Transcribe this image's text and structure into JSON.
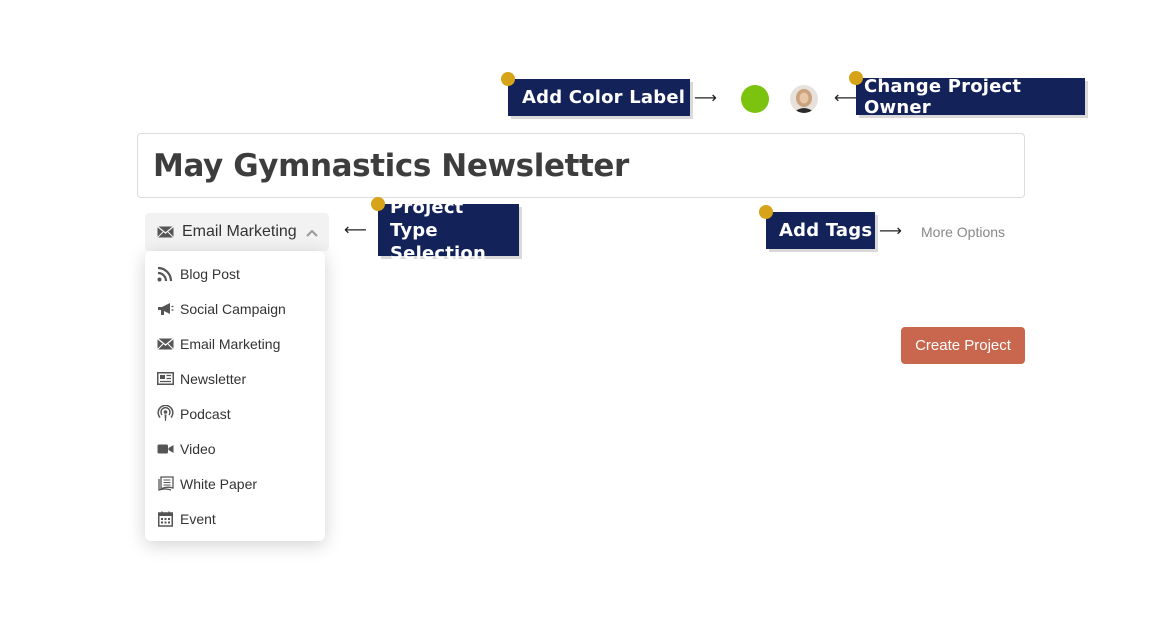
{
  "annotations": {
    "color_label": "Add Color Label",
    "project_owner": "Change Project Owner",
    "project_type": "Project Type Selection",
    "tags": "Add Tags"
  },
  "project": {
    "title": "May Gymnastics Newsletter",
    "color_label_color": "#7cc30f"
  },
  "type_selector": {
    "selected_label": "Email Marketing",
    "selected_icon": "envelope-icon"
  },
  "type_options": [
    {
      "label": "Blog Post",
      "icon": "rss-icon"
    },
    {
      "label": "Social Campaign",
      "icon": "megaphone-icon"
    },
    {
      "label": "Email Marketing",
      "icon": "envelope-icon"
    },
    {
      "label": "Newsletter",
      "icon": "newspaper-icon"
    },
    {
      "label": "Podcast",
      "icon": "podcast-icon"
    },
    {
      "label": "Video",
      "icon": "video-camera-icon"
    },
    {
      "label": "White Paper",
      "icon": "document-stack-icon"
    },
    {
      "label": "Event",
      "icon": "calendar-icon"
    }
  ],
  "more_options": "More Options",
  "create_button": "Create Project",
  "colors": {
    "callout_bg": "#14225a",
    "callout_dot": "#d6a319",
    "create_button": "#c8664e"
  }
}
